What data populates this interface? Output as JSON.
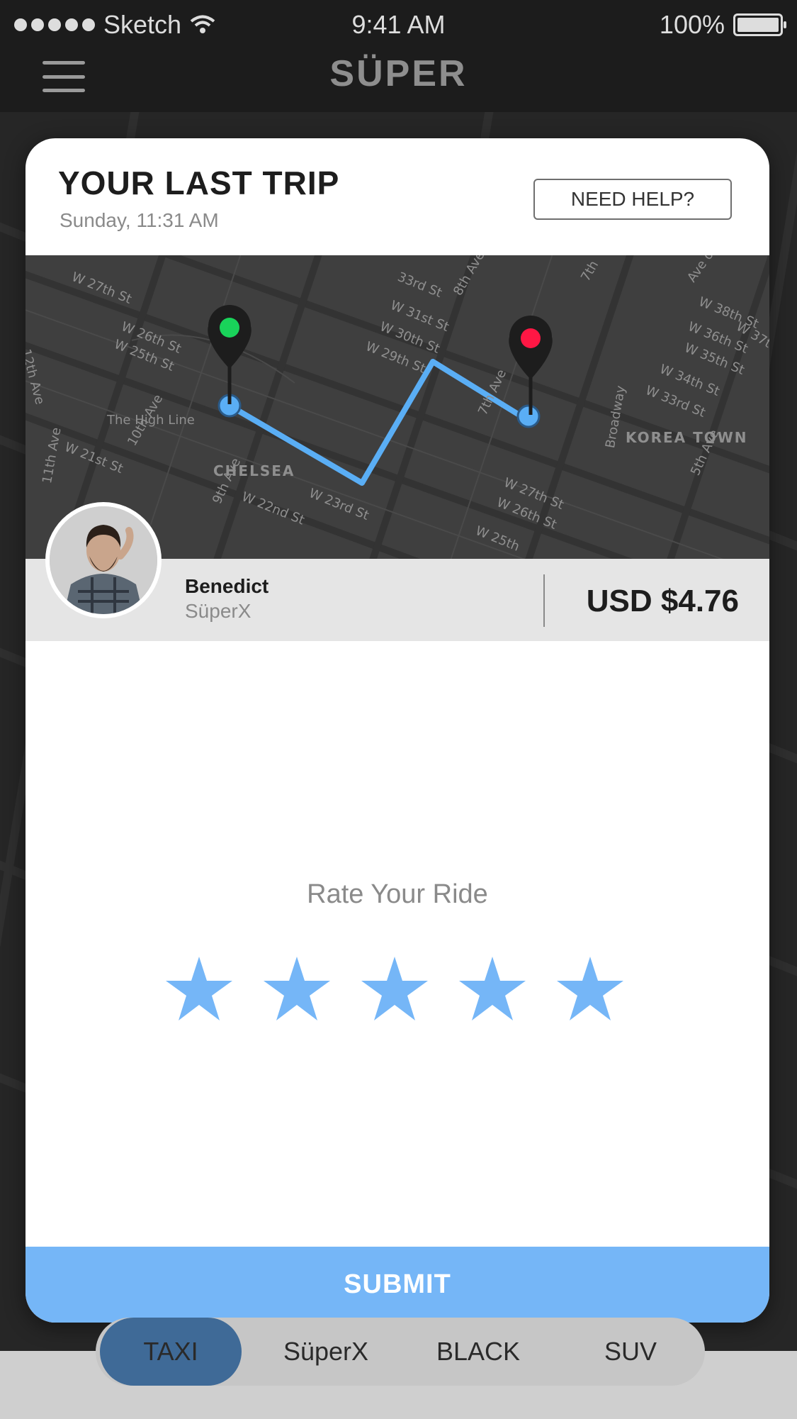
{
  "status_bar": {
    "carrier": "Sketch",
    "time": "9:41 AM",
    "battery": "100%"
  },
  "nav": {
    "title": "SÜPER",
    "menu_icon": "hamburger-menu-icon"
  },
  "trip": {
    "title": "YOUR LAST TRIP",
    "date": "Sunday, 11:31 AM",
    "help_label": "NEED HELP?"
  },
  "map": {
    "labels": [
      "W 27th St",
      "W 26th St",
      "W 25th St",
      "12th Ave",
      "The High Line",
      "W 21st St",
      "10th Ave",
      "11th Ave",
      "CHELSEA",
      "9th Ave",
      "W 22nd St",
      "W 23rd St",
      "W 31st St",
      "W 30th St",
      "W 29th St",
      "8th Ave",
      "7th Ave",
      "W 27th St",
      "W 26th St",
      "W 25th",
      "KOREA TOWN",
      "Broadway",
      "5th Ave",
      "W 38th St",
      "W 37th",
      "W 36th St",
      "W 35th St",
      "W 34th St",
      "W 33rd St",
      "7th",
      "33rd St",
      "Ave of"
    ],
    "route_color": "#5aaef5",
    "start_pin_color": "#19d35a",
    "end_pin_color": "#ff1744"
  },
  "driver": {
    "name": "Benedict",
    "class": "SüperX"
  },
  "fare": {
    "price": "USD $4.76"
  },
  "rating": {
    "label": "Rate Your Ride",
    "stars": 5,
    "star_color": "#75b6f7"
  },
  "submit_label": "SUBMIT",
  "tabs": [
    {
      "label": "TAXI",
      "active": true
    },
    {
      "label": "SüperX",
      "active": false
    },
    {
      "label": "BLACK",
      "active": false
    },
    {
      "label": "SUV",
      "active": false
    }
  ]
}
